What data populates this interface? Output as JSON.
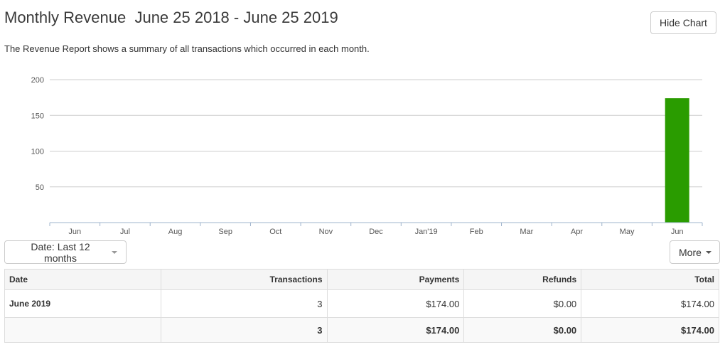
{
  "header": {
    "title": "Monthly Revenue",
    "date_range": "June 25 2018 - June 25 2019",
    "hide_chart_label": "Hide Chart",
    "description": "The Revenue Report shows a summary of all transactions which occurred in each month."
  },
  "chart_data": {
    "type": "bar",
    "categories": [
      "Jun",
      "Jul",
      "Aug",
      "Sep",
      "Oct",
      "Nov",
      "Dec",
      "Jan'19",
      "Feb",
      "Mar",
      "Apr",
      "May",
      "Jun"
    ],
    "values": [
      0,
      0,
      0,
      0,
      0,
      0,
      0,
      0,
      0,
      0,
      0,
      0,
      174
    ],
    "yticks": [
      50,
      100,
      150,
      200
    ],
    "ylim": [
      0,
      200
    ],
    "bar_color": "#2a9c00",
    "grid": true
  },
  "controls": {
    "date_filter_label": "Date: Last 12 months",
    "more_label": "More"
  },
  "table": {
    "columns": [
      "Date",
      "Transactions",
      "Payments",
      "Refunds",
      "Total"
    ],
    "rows": [
      [
        "June 2019",
        "3",
        "$174.00",
        "$0.00",
        "$174.00"
      ]
    ],
    "totals": [
      "",
      "3",
      "$174.00",
      "$0.00",
      "$174.00"
    ]
  },
  "colors": {
    "bar": "#2a9c00",
    "gridline": "#cccccc",
    "header_bg": "#f5f5f5"
  }
}
